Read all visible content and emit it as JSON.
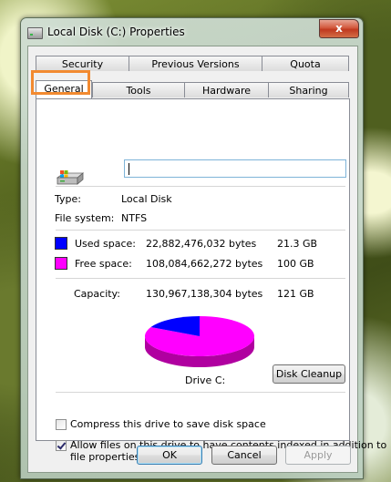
{
  "window": {
    "title": "Local Disk (C:) Properties",
    "close_label": "x"
  },
  "tabs": {
    "row1": [
      "Security",
      "Previous Versions",
      "Quota"
    ],
    "row2": [
      "General",
      "Tools",
      "Hardware",
      "Sharing"
    ],
    "active": "General"
  },
  "general": {
    "name_value": "",
    "type_label": "Type:",
    "type_value": "Local Disk",
    "fs_label": "File system:",
    "fs_value": "NTFS",
    "used_label": "Used space:",
    "used_bytes": "22,882,476,032 bytes",
    "used_gb": "21.3 GB",
    "free_label": "Free space:",
    "free_bytes": "108,084,662,272 bytes",
    "free_gb": "100 GB",
    "capacity_label": "Capacity:",
    "capacity_bytes": "130,967,138,304 bytes",
    "capacity_gb": "121 GB",
    "drive_label": "Drive C:",
    "cleanup_label": "Disk Cleanup",
    "compress_label": "Compress this drive to save disk space",
    "compress_checked": false,
    "index_label_1": "Allow files on this drive to have contents indexed in addition to",
    "index_label_2": "file properties",
    "index_checked": true
  },
  "colors": {
    "used": "#0000ff",
    "free": "#ff00ff",
    "used_dark": "#00008b",
    "free_dark": "#b000a0",
    "highlight": "#f28a30"
  },
  "usage": {
    "used_fraction": 0.175
  },
  "buttons": {
    "ok": "OK",
    "cancel": "Cancel",
    "apply": "Apply"
  }
}
